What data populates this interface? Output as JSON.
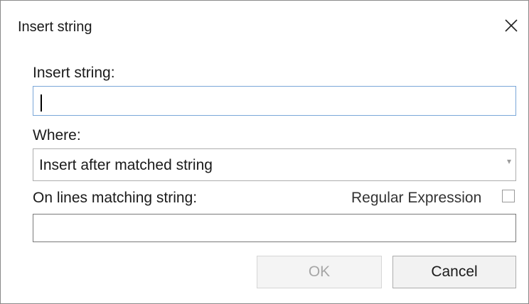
{
  "window": {
    "title": "Insert string",
    "close_icon": "close-icon"
  },
  "insert_field": {
    "label": "Insert string:",
    "value": ""
  },
  "where": {
    "label": "Where:",
    "selected": "Insert after matched string",
    "arrow": "▾"
  },
  "matching": {
    "label": "On lines matching string:",
    "value": ""
  },
  "regex": {
    "label": "Regular Expression",
    "checked": false
  },
  "buttons": {
    "ok": "OK",
    "ok_disabled": true,
    "cancel": "Cancel"
  },
  "colors": {
    "focus_border": "#7aa7d8",
    "disabled_text": "#a6a6a6"
  }
}
